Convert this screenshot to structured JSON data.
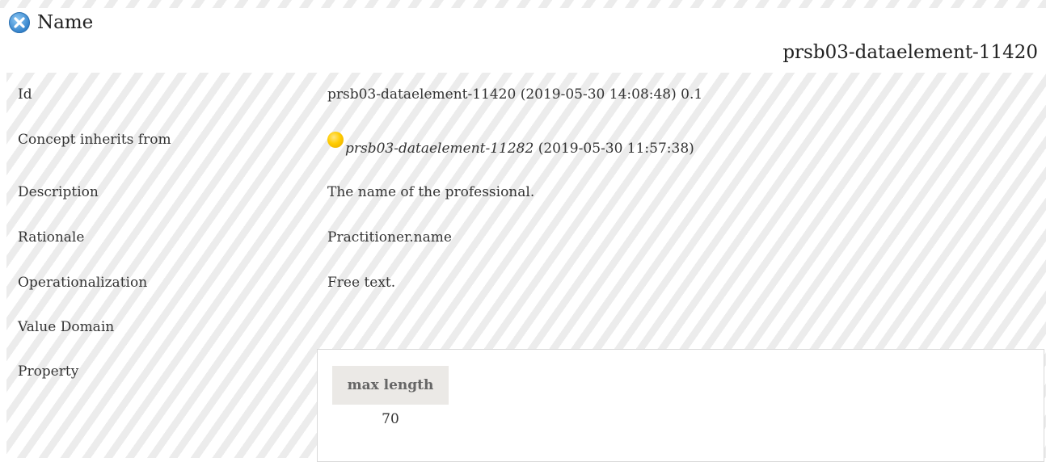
{
  "header": {
    "title": "Name",
    "id": "prsb03-dataelement-11420"
  },
  "rows": [
    {
      "label": "Id",
      "value": "prsb03-dataelement-11420 (2019-05-30 14:08:48) 0.1"
    },
    {
      "label": "Concept inherits from",
      "value_link": "prsb03-dataelement-11282",
      "value_suffix": " (2019-05-30 11:57:38)"
    },
    {
      "label": "Description",
      "value": "The name of the professional."
    },
    {
      "label": "Rationale",
      "value": "Practitioner.name"
    },
    {
      "label": "Operationalization",
      "value": "Free text."
    },
    {
      "label": "Value Domain",
      "value": ""
    },
    {
      "label": "Property",
      "value": ""
    }
  ],
  "property": {
    "header": "max length",
    "value": "70"
  },
  "colors": {
    "hatch_stripe": "#ececec",
    "status_dot": "#ffcc00",
    "close_icon": "#3b8fd6"
  },
  "icons": {
    "close": "close-circle-icon",
    "status": "status-dot-icon"
  }
}
